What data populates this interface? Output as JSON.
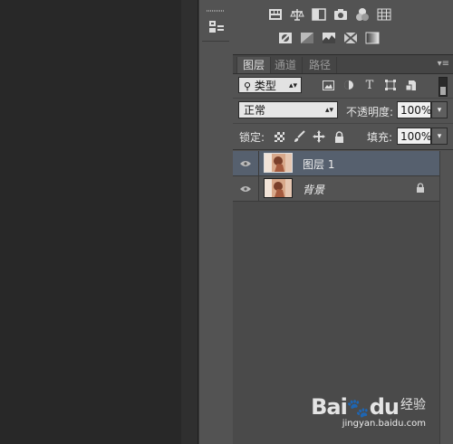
{
  "layers_panel": {
    "tabs": [
      {
        "label": "图层"
      },
      {
        "label": "通道"
      },
      {
        "label": "路径"
      }
    ],
    "filter": {
      "kind_label": "类型"
    },
    "blend_mode": "正常",
    "opacity_label": "不透明度:",
    "opacity_value": "100%",
    "lock_label": "锁定:",
    "fill_label": "填充:",
    "fill_value": "100%",
    "layers": [
      {
        "name": "图层 1",
        "selected": true
      },
      {
        "name": "背景",
        "locked": true
      }
    ]
  },
  "watermark": {
    "brand": "Bai",
    "brand2": "du",
    "jingyan": "经验",
    "url": "jingyan.baidu.com"
  },
  "colors": {
    "panel_bg": "#535353",
    "selected_row": "#56606e",
    "canvas_bg": "#282828"
  }
}
